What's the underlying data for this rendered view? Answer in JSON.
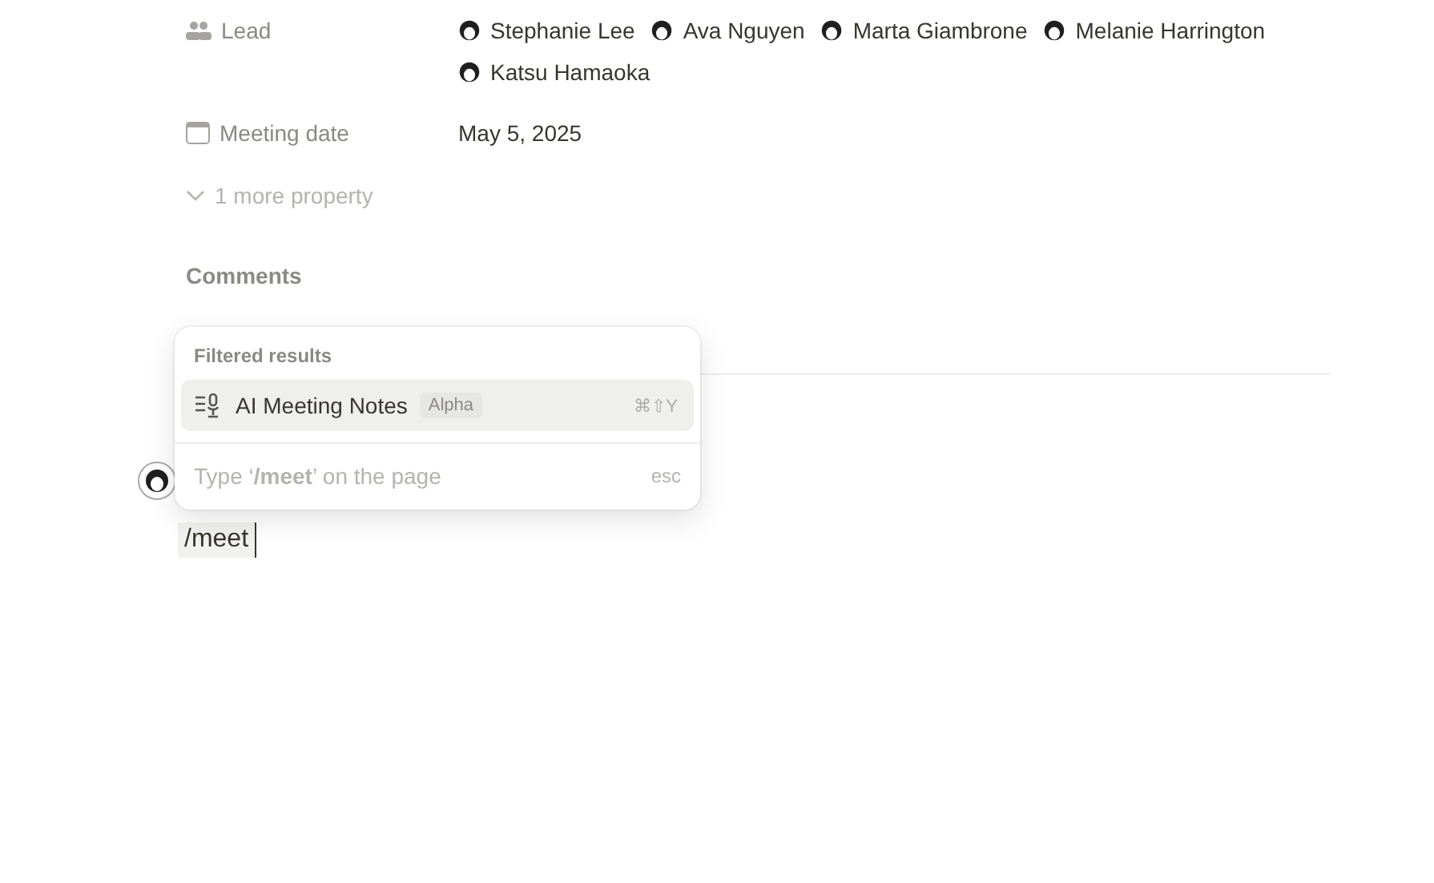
{
  "properties": [
    {
      "kind": "people",
      "label": "Lead",
      "people": [
        {
          "name": "Stephanie Lee"
        },
        {
          "name": "Ava Nguyen"
        },
        {
          "name": "Marta Giambrone"
        },
        {
          "name": "Melanie Harrington"
        },
        {
          "name": "Katsu Hamaoka"
        }
      ]
    },
    {
      "kind": "date",
      "label": "Meeting date",
      "value": "May 5, 2025"
    }
  ],
  "more_properties": {
    "label": "1 more property",
    "expanded": false
  },
  "comments": {
    "title": "Comments"
  },
  "menu": {
    "header": "Filtered results",
    "items": [
      {
        "label": "AI Meeting Notes",
        "badge": "Alpha",
        "shortcut": "⌘⇧Y",
        "selected": true
      }
    ],
    "footer": {
      "text": "Type ‘**/meet**’ on the page",
      "hint": "esc"
    }
  },
  "editor": {
    "text": "/meet"
  }
}
